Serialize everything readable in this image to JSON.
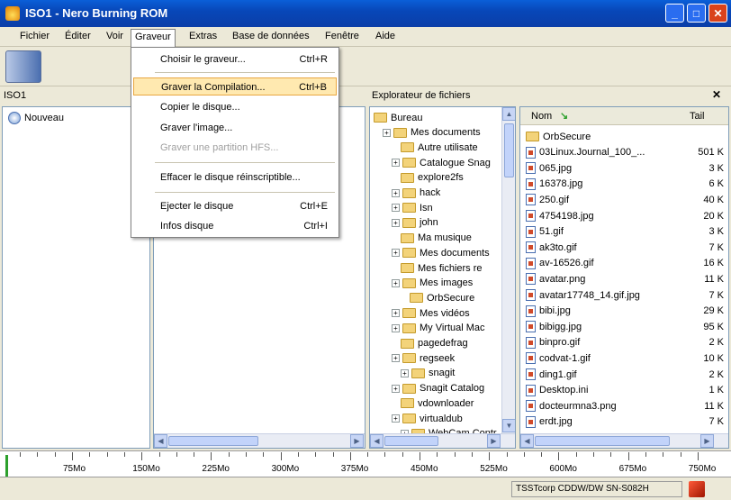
{
  "window": {
    "title": "ISO1 - Nero Burning ROM"
  },
  "menubar": {
    "items": [
      "Fichier",
      "Éditer",
      "Voir",
      "Graveur",
      "Extras",
      "Base de données",
      "Fenêtre",
      "Aide"
    ]
  },
  "left_panel": {
    "header": "ISO1",
    "new_item": "Nouveau"
  },
  "explorer": {
    "header": "Explorateur de fichiers"
  },
  "tree": {
    "items": [
      "Bureau",
      "Mes documents",
      "Autre utilisate",
      "Catalogue Snag",
      "explore2fs",
      "hack",
      "Isn",
      "john",
      "Ma musique",
      "Mes documents",
      "Mes fichiers re",
      "Mes images",
      "OrbSecure",
      "Mes vidéos",
      "My Virtual Mac",
      "pagedefrag",
      "regseek",
      "snagit",
      "Snagit Catalog",
      "vdownloader",
      "virtualdub",
      "WebCam Contr"
    ]
  },
  "files": {
    "columns": [
      "Nom",
      "Tail"
    ],
    "rows": [
      {
        "name": "OrbSecure",
        "size": "",
        "type": "folder"
      },
      {
        "name": "03Linux.Journal_100_...",
        "size": "501 K",
        "type": "file"
      },
      {
        "name": "065.jpg",
        "size": "3 K",
        "type": "file"
      },
      {
        "name": "16378.jpg",
        "size": "6 K",
        "type": "file"
      },
      {
        "name": "250.gif",
        "size": "40 K",
        "type": "file"
      },
      {
        "name": "4754198.jpg",
        "size": "20 K",
        "type": "file"
      },
      {
        "name": "51.gif",
        "size": "3 K",
        "type": "file"
      },
      {
        "name": "ak3to.gif",
        "size": "7 K",
        "type": "file"
      },
      {
        "name": "av-16526.gif",
        "size": "16 K",
        "type": "file"
      },
      {
        "name": "avatar.png",
        "size": "11 K",
        "type": "file"
      },
      {
        "name": "avatar17748_14.gif.jpg",
        "size": "7 K",
        "type": "file"
      },
      {
        "name": "bibi.jpg",
        "size": "29 K",
        "type": "file"
      },
      {
        "name": "bibigg.jpg",
        "size": "95 K",
        "type": "file"
      },
      {
        "name": "binpro.gif",
        "size": "2 K",
        "type": "file"
      },
      {
        "name": "codvat-1.gif",
        "size": "10 K",
        "type": "file"
      },
      {
        "name": "ding1.gif",
        "size": "2 K",
        "type": "file"
      },
      {
        "name": "Desktop.ini",
        "size": "1 K",
        "type": "file"
      },
      {
        "name": "docteurmna3.png",
        "size": "11 K",
        "type": "file"
      },
      {
        "name": "erdt.jpg",
        "size": "7 K",
        "type": "file"
      }
    ]
  },
  "dropdown": {
    "items": [
      {
        "label": "Choisir le graveur...",
        "shortcut": "Ctrl+R",
        "state": "normal"
      },
      {
        "label": "Graver la Compilation...",
        "shortcut": "Ctrl+B",
        "state": "highlight"
      },
      {
        "label": "Copier le disque...",
        "shortcut": "",
        "state": "normal"
      },
      {
        "label": "Graver l'image...",
        "shortcut": "",
        "state": "normal"
      },
      {
        "label": "Graver une partition HFS...",
        "shortcut": "",
        "state": "disabled"
      },
      {
        "label": "Effacer le disque réinscriptible...",
        "shortcut": "",
        "state": "normal"
      },
      {
        "label": "Ejecter le disque",
        "shortcut": "Ctrl+E",
        "state": "normal"
      },
      {
        "label": "Infos disque",
        "shortcut": "Ctrl+I",
        "state": "normal"
      }
    ]
  },
  "ruler": {
    "labels": [
      "75Mo",
      "150Mo",
      "225Mo",
      "300Mo",
      "375Mo",
      "450Mo",
      "525Mo",
      "600Mo",
      "675Mo",
      "750Mo"
    ]
  },
  "status": {
    "drive": "TSSTcorp CDDW/DW SN-S082H"
  },
  "colors": {
    "titlebar": "#0847b8",
    "highlight": "#ffe9b0",
    "close_button": "#d9421b"
  }
}
